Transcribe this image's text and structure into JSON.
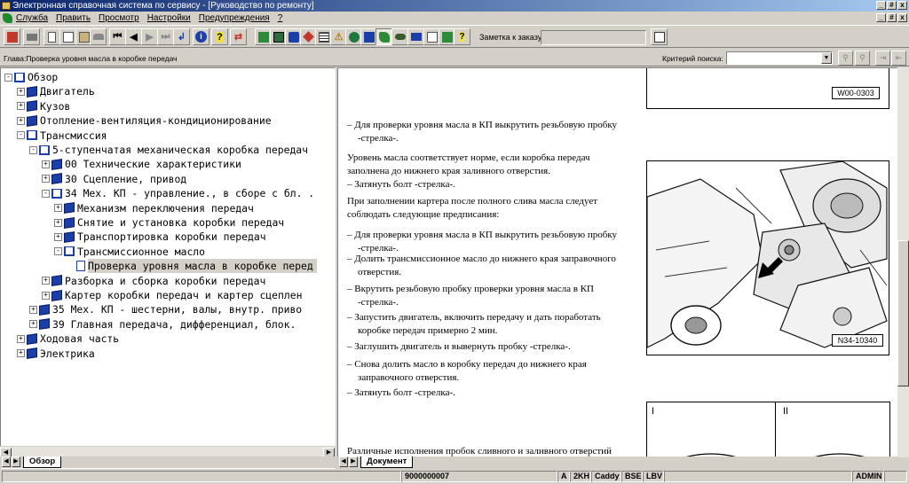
{
  "window": {
    "title": "Электронная справочная система по сервису - [Руководство по ремонту]",
    "caption_buttons": [
      "_",
      "#",
      "x"
    ]
  },
  "menu": [
    "Служба",
    "Править",
    "Просмотр",
    "Настройки",
    "Предупреждения",
    "?"
  ],
  "toolbar": {
    "buttons": [
      "exit",
      "print",
      "new-document",
      "edit",
      "clipboard",
      "vehicle",
      "first",
      "previous",
      "next",
      "last",
      "back",
      "info",
      "help",
      "swap",
      "tools",
      "calculator",
      "parts",
      "diagnostic",
      "list",
      "warning",
      "globe",
      "save",
      "bookmark",
      "car",
      "mail",
      "checklist",
      "notes",
      "help-book"
    ],
    "note_label": "Заметка к заказу:",
    "note_value": ""
  },
  "crumb": {
    "text": "Глава:Проверка уровня масла в коробке передач",
    "criteria_label": "Критерий поиска:",
    "criteria_value": ""
  },
  "tree": [
    {
      "label": "Обзор",
      "state": "-",
      "icon": "open-book"
    },
    {
      "label": "Двигатель",
      "state": "+",
      "icon": "book"
    },
    {
      "label": "Кузов",
      "state": "+",
      "icon": "book"
    },
    {
      "label": "Отопление-вентиляция-кондиционирование",
      "state": "+",
      "icon": "book"
    },
    {
      "label": "Трансмиссия",
      "state": "-",
      "icon": "open-book"
    },
    {
      "label": "5-ступенчатая механическая коробка передач",
      "state": "-",
      "icon": "open-book"
    },
    {
      "label": "00 Технические характеристики",
      "state": "+",
      "icon": "book"
    },
    {
      "label": "30 Сцепление, привод",
      "state": "+",
      "icon": "book"
    },
    {
      "label": "34 Мех. КП - управление., в сборе с бл. .",
      "state": "-",
      "icon": "open-book"
    },
    {
      "label": "Механизм переключения передач",
      "state": "+",
      "icon": "book"
    },
    {
      "label": "Снятие и установка коробки передач",
      "state": "+",
      "icon": "book"
    },
    {
      "label": "Транспортировка коробки передач",
      "state": "+",
      "icon": "book"
    },
    {
      "label": "Трансмиссионное масло",
      "state": "-",
      "icon": "open-book"
    },
    {
      "label": "Проверка уровня масла в коробке перед",
      "state": "",
      "icon": "page",
      "selected": true
    },
    {
      "label": "Разборка и сборка коробки передач",
      "state": "+",
      "icon": "book"
    },
    {
      "label": "Картер коробки передач и картер сцеплен",
      "state": "+",
      "icon": "book"
    },
    {
      "label": "35 Мех. КП - шестерни, валы, внутр. приво",
      "state": "+",
      "icon": "book"
    },
    {
      "label": "39 Главная передача, дифференциал, блок.",
      "state": "+",
      "icon": "book"
    },
    {
      "label": "Ходовая часть",
      "state": "+",
      "icon": "book"
    },
    {
      "label": "Электрика",
      "state": "+",
      "icon": "book"
    }
  ],
  "tabs": {
    "left": "Обзор",
    "right": "Документ"
  },
  "document": {
    "paragraphs": [
      {
        "text": "– Для проверки уровня масла в КП выкрутить резьбовую пробку -стрелка-.",
        "bullet": true
      },
      {
        "text": "Уровень масла соответствует норме, если коробка передач заполнена до нижнего края заливного отверстия.",
        "bullet": false
      },
      {
        "text": "– Затянуть болт -стрелка-.",
        "bullet": true
      },
      {
        "text": "При заполнении картера после полного слива масла следует соблюдать следующие предписания:",
        "bullet": false
      },
      {
        "text": "– Для проверки уровня масла в КП выкрутить резьбовую пробку -стрелка-.",
        "bullet": true
      },
      {
        "text": "– Долить трансмиссионное масло до нижнего края заправочного отверстия.",
        "bullet": true
      },
      {
        "text": "– Вкрутить резьбовую пробку проверки уровня масла в КП -стрелка-.",
        "bullet": true
      },
      {
        "text": "– Запустить двигатель, включить передачу и дать поработать коробке передач примерно 2 мин.",
        "bullet": true
      },
      {
        "text": "– Заглушить двигатель и вывернуть пробку -стрелка-.",
        "bullet": true
      },
      {
        "text": "– Снова долить масло в коробку передач до нижнего края заправочного отверстия.",
        "bullet": true
      },
      {
        "text": "– Затянуть болт -стрелка-.",
        "bullet": true
      },
      {
        "text": "Различные исполнения пробок сливного и заливного отверстий",
        "bullet": false
      }
    ],
    "figures": {
      "top_label": "W00-0303",
      "photo_label": "N34-10340",
      "panel_left": "I",
      "panel_right": "II"
    }
  },
  "status": {
    "order": "9000000007",
    "codes": [
      "A",
      "2KH",
      "Caddy",
      "BSE",
      "LBV"
    ],
    "user": "ADMIN"
  }
}
